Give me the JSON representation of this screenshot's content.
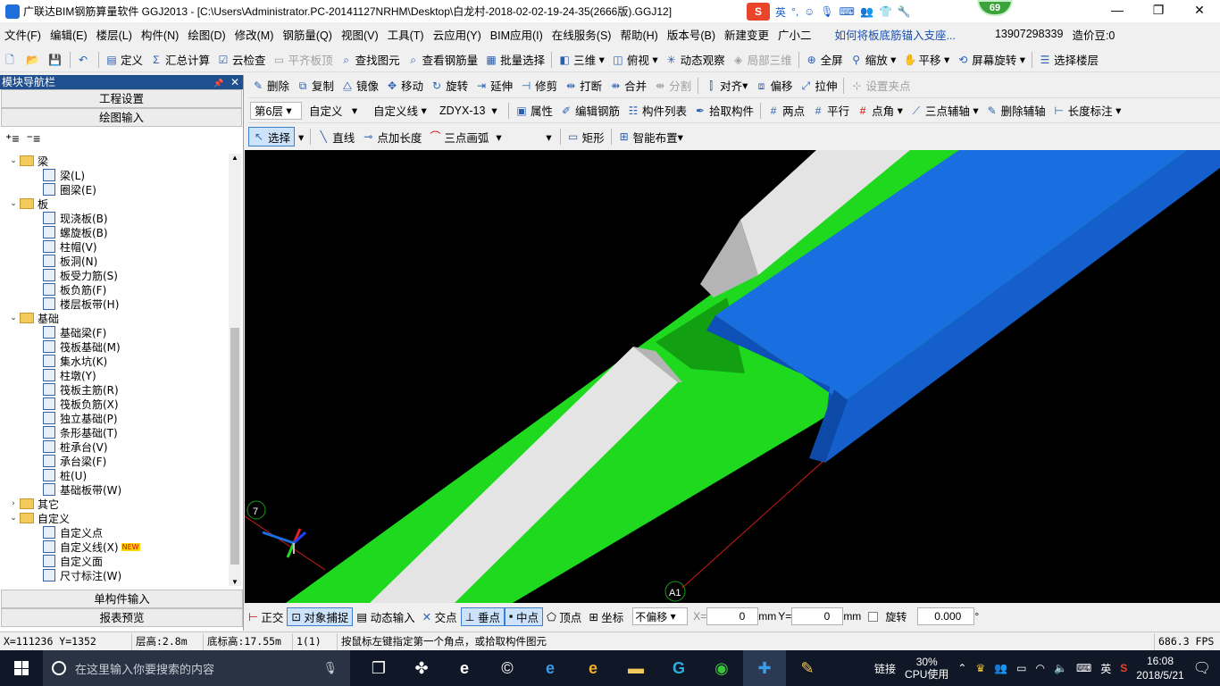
{
  "title": "广联达BIM钢筋算量软件 GGJ2013 - [C:\\Users\\Administrator.PC-20141127NRHM\\Desktop\\白龙村-2018-02-02-19-24-35(2666版).GGJ12]",
  "ime": {
    "logo": "S",
    "lang": "英",
    "badge": "69"
  },
  "window": {
    "minimize": "—",
    "restore": "❐",
    "close": "✕"
  },
  "menu": [
    "文件(F)",
    "编辑(E)",
    "楼层(L)",
    "构件(N)",
    "绘图(D)",
    "修改(M)",
    "钢筋量(Q)",
    "视图(V)",
    "工具(T)",
    "云应用(Y)",
    "BIM应用(I)",
    "在线服务(S)",
    "帮助(H)",
    "版本号(B)",
    "新建变更",
    "广小二"
  ],
  "menu_link": "如何将板底筋锚入支座...",
  "menu_phone": "13907298339",
  "menu_price": "造价豆:0",
  "toolbar1": {
    "dingyi": "定义",
    "huizong": "汇总计算",
    "yunjiancha": "云检查",
    "pingqi": "平齐板顶",
    "chazhao": "查找图元",
    "chakan": "查看钢筋量",
    "piliang": "批量选择",
    "sanwei": "三维",
    "fushi": "俯视",
    "dongtai": "动态观察",
    "jubu": "局部三维",
    "quanping": "全屏",
    "suofang": "缩放",
    "pingyi": "平移",
    "pingmu": "屏幕旋转",
    "xuanze": "选择楼层"
  },
  "toolbar2": {
    "shanchu": "删除",
    "fuzhi": "复制",
    "jingxiang": "镜像",
    "yidong": "移动",
    "xuanzhuan": "旋转",
    "yanshen": "延伸",
    "xiujian": "修剪",
    "dada": "打断",
    "hebing": "合并",
    "fenge": "分割",
    "duiqi": "对齐",
    "pianyi": "偏移",
    "lashen": "拉伸",
    "shezhi": "设置夹点"
  },
  "toolbar3": {
    "floor": "第6层",
    "type1": "自定义",
    "type2": "自定义线",
    "code": "ZDYX-13",
    "shuxing": "属性",
    "bianji": "编辑钢筋",
    "liebiao": "构件列表",
    "shiqu": "拾取构件",
    "liangdian": "两点",
    "pingxing": "平行",
    "dianjiao": "点角",
    "sandian": "三点辅轴",
    "shanchufz": "删除辅轴",
    "changdu": "长度标注"
  },
  "toolbar4": {
    "xuanze": "选择",
    "zhixian": "直线",
    "dianjia": "点加长度",
    "sandianhu": "三点画弧",
    "juxing": "矩形",
    "zhineng": "智能布置"
  },
  "nav": {
    "title": "模块导航栏",
    "pin": "📌",
    "close": "✕",
    "gcsz": "工程设置",
    "htsr": "绘图输入",
    "dgj": "单构件输入",
    "bbyl": "报表预览"
  },
  "tree": [
    {
      "lvl": 1,
      "exp": "⌄",
      "folder": true,
      "label": "梁"
    },
    {
      "lvl": 2,
      "label": "梁(L)"
    },
    {
      "lvl": 2,
      "label": "圈梁(E)"
    },
    {
      "lvl": 1,
      "exp": "⌄",
      "folder": true,
      "label": "板"
    },
    {
      "lvl": 2,
      "label": "现浇板(B)"
    },
    {
      "lvl": 2,
      "label": "螺旋板(B)"
    },
    {
      "lvl": 2,
      "label": "柱帽(V)"
    },
    {
      "lvl": 2,
      "label": "板洞(N)"
    },
    {
      "lvl": 2,
      "label": "板受力筋(S)"
    },
    {
      "lvl": 2,
      "label": "板负筋(F)"
    },
    {
      "lvl": 2,
      "label": "楼层板带(H)"
    },
    {
      "lvl": 1,
      "exp": "⌄",
      "folder": true,
      "label": "基础"
    },
    {
      "lvl": 2,
      "label": "基础梁(F)"
    },
    {
      "lvl": 2,
      "label": "筏板基础(M)"
    },
    {
      "lvl": 2,
      "label": "集水坑(K)"
    },
    {
      "lvl": 2,
      "label": "柱墩(Y)"
    },
    {
      "lvl": 2,
      "label": "筏板主筋(R)"
    },
    {
      "lvl": 2,
      "label": "筏板负筋(X)"
    },
    {
      "lvl": 2,
      "label": "独立基础(P)"
    },
    {
      "lvl": 2,
      "label": "条形基础(T)"
    },
    {
      "lvl": 2,
      "label": "桩承台(V)"
    },
    {
      "lvl": 2,
      "label": "承台梁(F)"
    },
    {
      "lvl": 2,
      "label": "桩(U)"
    },
    {
      "lvl": 2,
      "label": "基础板带(W)"
    },
    {
      "lvl": 1,
      "exp": "›",
      "folder": true,
      "label": "其它"
    },
    {
      "lvl": 1,
      "exp": "⌄",
      "folder": true,
      "label": "自定义"
    },
    {
      "lvl": 2,
      "label": "自定义点"
    },
    {
      "lvl": 2,
      "label": "自定义线(X)",
      "newtag": "NEW"
    },
    {
      "lvl": 2,
      "label": "自定义面"
    },
    {
      "lvl": 2,
      "label": "尺寸标注(W)"
    }
  ],
  "canvas": {
    "axis_label_7": "7",
    "axis_label_a1": "A1"
  },
  "snapbar": {
    "zhengjiao": "正交",
    "duixiang": "对象捕捉",
    "dongtai": "动态输入",
    "jiaodian": "交点",
    "chuidian": "垂点",
    "zhongdian": "中点",
    "dingdian": "顶点",
    "zuobiao": "坐标",
    "pianyi": "不偏移",
    "x_label": "X=",
    "x_val": "0",
    "mm1": "mm",
    "y_label": "Y=",
    "y_val": "0",
    "mm2": "mm",
    "xuanzhuan": "旋转",
    "rot_val": "0.000",
    "deg": "°"
  },
  "status": {
    "coords": "X=111236 Y=1352",
    "cenggao": "层高:2.8m",
    "digao": "底标高:17.55m",
    "count": "1(1)",
    "hint": "按鼠标左键指定第一个角点，或拾取构件图元",
    "fps": "686.3 FPS"
  },
  "taskbar": {
    "search": "在这里输入你要搜索的内容",
    "link": "链接",
    "cpu_pct": "30%",
    "cpu_label": "CPU使用",
    "lang": "英",
    "time": "16:08",
    "date": "2018/5/21"
  },
  "colors": {
    "canvas_bg": "#000000",
    "green": "#1fd91f",
    "blue": "#1a6fe0",
    "white_beam": "#e4e4e4"
  }
}
